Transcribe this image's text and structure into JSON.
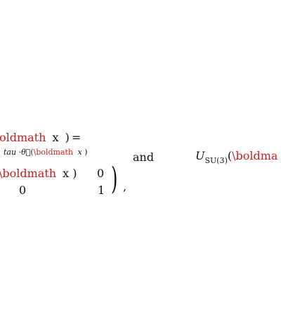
{
  "line1": {
    "cmd_tail": "oldmath",
    "var": "x",
    "close_paren": ")",
    "equals": "="
  },
  "exponent": {
    "prefix": "tau",
    "dot": "·",
    "theta_vec": "θ⃗",
    "open_paren": "(",
    "backslash": "\\",
    "cmd": "boldmath",
    "var": "x",
    "close_paren": ")"
  },
  "matrix": {
    "row1_backslash": "\\",
    "row1_cmd": "boldmath",
    "row1_var": "x",
    "row1_close": ")",
    "row1_col2": "0",
    "row2_col1": "0",
    "row2_col2": "1",
    "big_paren": ")",
    "comma": ","
  },
  "conjunction": "and",
  "right_expr": {
    "U": "U",
    "subscript": "SU(3)",
    "open_paren": "(",
    "backslash": "\\",
    "cmd_head": "boldma"
  }
}
